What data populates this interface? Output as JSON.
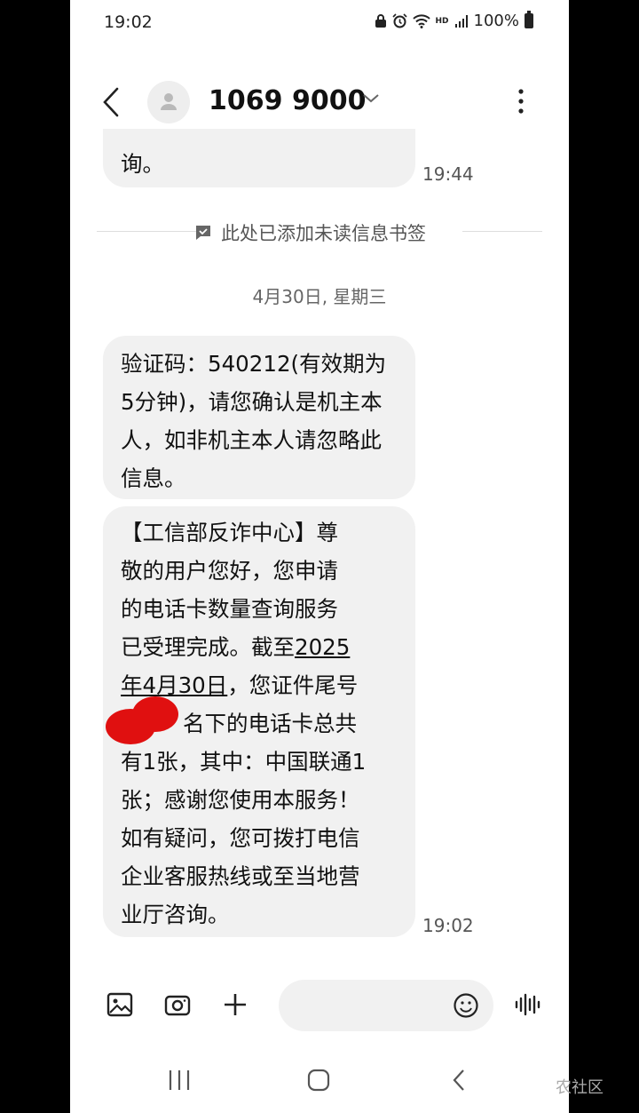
{
  "status_bar": {
    "time": "19:02",
    "hd_label": "HD",
    "battery_text": "100%"
  },
  "header": {
    "title": "1069 9000",
    "icons": [
      "back-arrow-icon",
      "avatar-person-icon",
      "chevron-down-icon",
      "more-vertical-icon"
    ]
  },
  "messages": [
    {
      "text": "询。",
      "time": "19:44"
    },
    {
      "text": "验证码：540212(有效期为5分钟)，请您确认是机主本人，如非机主本人请忽略此信息。"
    },
    {
      "lines": [
        "【工信部反诈中心】尊",
        "敬的用户您好，您申请",
        "的电话卡数量查询服务",
        "已受理完成。截至",
        "2025",
        "年4月30日",
        "，您证件尾号",
        "名下的电话卡总共",
        "有1张，其中：中国联通1",
        "张；感谢您使用本服务！",
        "如有疑问，您可拨打电信",
        "企业客服热线或至当地营",
        "业厅咨询。"
      ],
      "time": "19:02"
    }
  ],
  "bookmark_divider": {
    "text": "此处已添加未读信息书签",
    "icon": "bookmark-message-icon"
  },
  "date_separator": "4月30日, 星期三",
  "input_bar": {
    "icons": [
      "gallery-icon",
      "camera-icon",
      "plus-icon",
      "emoji-icon",
      "voice-icon"
    ]
  },
  "nav_bar": {
    "icons": [
      "recents-icon",
      "home-icon",
      "back-icon"
    ]
  },
  "watermark": "农社区",
  "colors": {
    "bubble": "#f1f1f1",
    "redaction": "#e01010",
    "background": "#ffffff"
  }
}
